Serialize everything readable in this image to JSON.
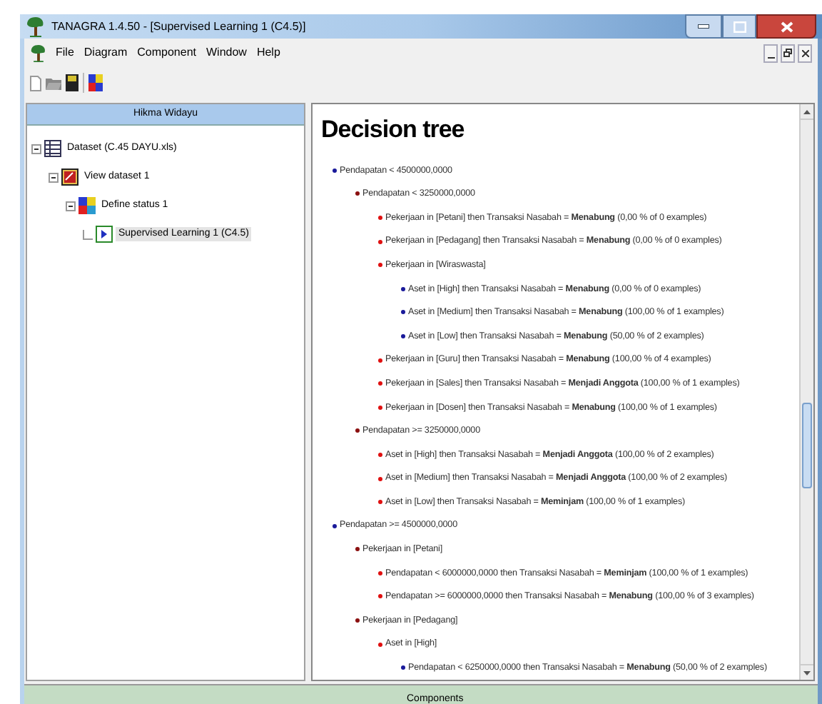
{
  "window": {
    "title": "TANAGRA 1.4.50 - [Supervised Learning 1 (C4.5)]"
  },
  "menu": [
    "File",
    "Diagram",
    "Component",
    "Window",
    "Help"
  ],
  "left_panel": {
    "title": "Hikma Widayu",
    "tree": [
      {
        "label": "Dataset (C.45 DAYU.xls)",
        "kind": "dataset",
        "selected": false,
        "children": [
          {
            "label": "View dataset 1",
            "kind": "view",
            "selected": false,
            "children": [
              {
                "label": "Define status 1",
                "kind": "define",
                "selected": false,
                "children": [
                  {
                    "label": "Supervised Learning 1 (C4.5)",
                    "kind": "learning",
                    "selected": true
                  }
                ]
              }
            ]
          }
        ]
      }
    ]
  },
  "result": {
    "heading": "Decision tree",
    "rules": [
      {
        "text": "Pendapatan < 4500000,0000",
        "children": [
          {
            "text": "Pendapatan < 3250000,0000",
            "children": [
              {
                "text": "Pekerjaan in [Petani] then Transaksi Nasabah = **Menabung** (0,00 % of 0 examples)"
              },
              {
                "text": "Pekerjaan in [Pedagang] then Transaksi Nasabah = **Menabung** (0,00 % of 0 examples)"
              },
              {
                "text": "Pekerjaan in [Wiraswasta]",
                "children": [
                  {
                    "text": "Aset in [High] then Transaksi Nasabah = **Menabung** (0,00 % of 0 examples)"
                  },
                  {
                    "text": "Aset in [Medium] then Transaksi Nasabah = **Menabung** (100,00 % of 1 examples)"
                  },
                  {
                    "text": "Aset in [Low] then Transaksi Nasabah = **Menabung** (50,00 % of 2 examples)"
                  }
                ]
              },
              {
                "text": "Pekerjaan in [Guru] then Transaksi Nasabah = **Menabung** (100,00 % of 4 examples)"
              },
              {
                "text": "Pekerjaan in [Sales] then Transaksi Nasabah = **Menjadi Anggota** (100,00 % of 1 examples)"
              },
              {
                "text": "Pekerjaan in [Dosen] then Transaksi Nasabah = **Menabung** (100,00 % of 1 examples)"
              }
            ]
          },
          {
            "text": "Pendapatan >= 3250000,0000",
            "children": [
              {
                "text": "Aset in [High] then Transaksi Nasabah = **Menjadi Anggota** (100,00 % of 2 examples)"
              },
              {
                "text": "Aset in [Medium] then Transaksi Nasabah = **Menjadi Anggota** (100,00 % of 2 examples)"
              },
              {
                "text": "Aset in [Low] then Transaksi Nasabah = **Meminjam** (100,00 % of 1 examples)"
              }
            ]
          }
        ]
      },
      {
        "text": "Pendapatan >= 4500000,0000",
        "children": [
          {
            "text": "Pekerjaan in [Petani]",
            "children": [
              {
                "text": "Pendapatan < 6000000,0000 then Transaksi Nasabah = **Meminjam** (100,00 % of 1 examples)"
              },
              {
                "text": "Pendapatan >= 6000000,0000 then Transaksi Nasabah = **Menabung** (100,00 % of 3 examples)"
              }
            ]
          },
          {
            "text": "Pekerjaan in [Pedagang]",
            "children": [
              {
                "text": "Aset in [High]",
                "children": [
                  {
                    "text": "Pendapatan < 6250000,0000 then Transaksi Nasabah = **Menabung** (50,00 % of 2 examples)"
                  }
                ]
              }
            ]
          }
        ]
      }
    ]
  },
  "components_bar": {
    "title": "Components"
  }
}
